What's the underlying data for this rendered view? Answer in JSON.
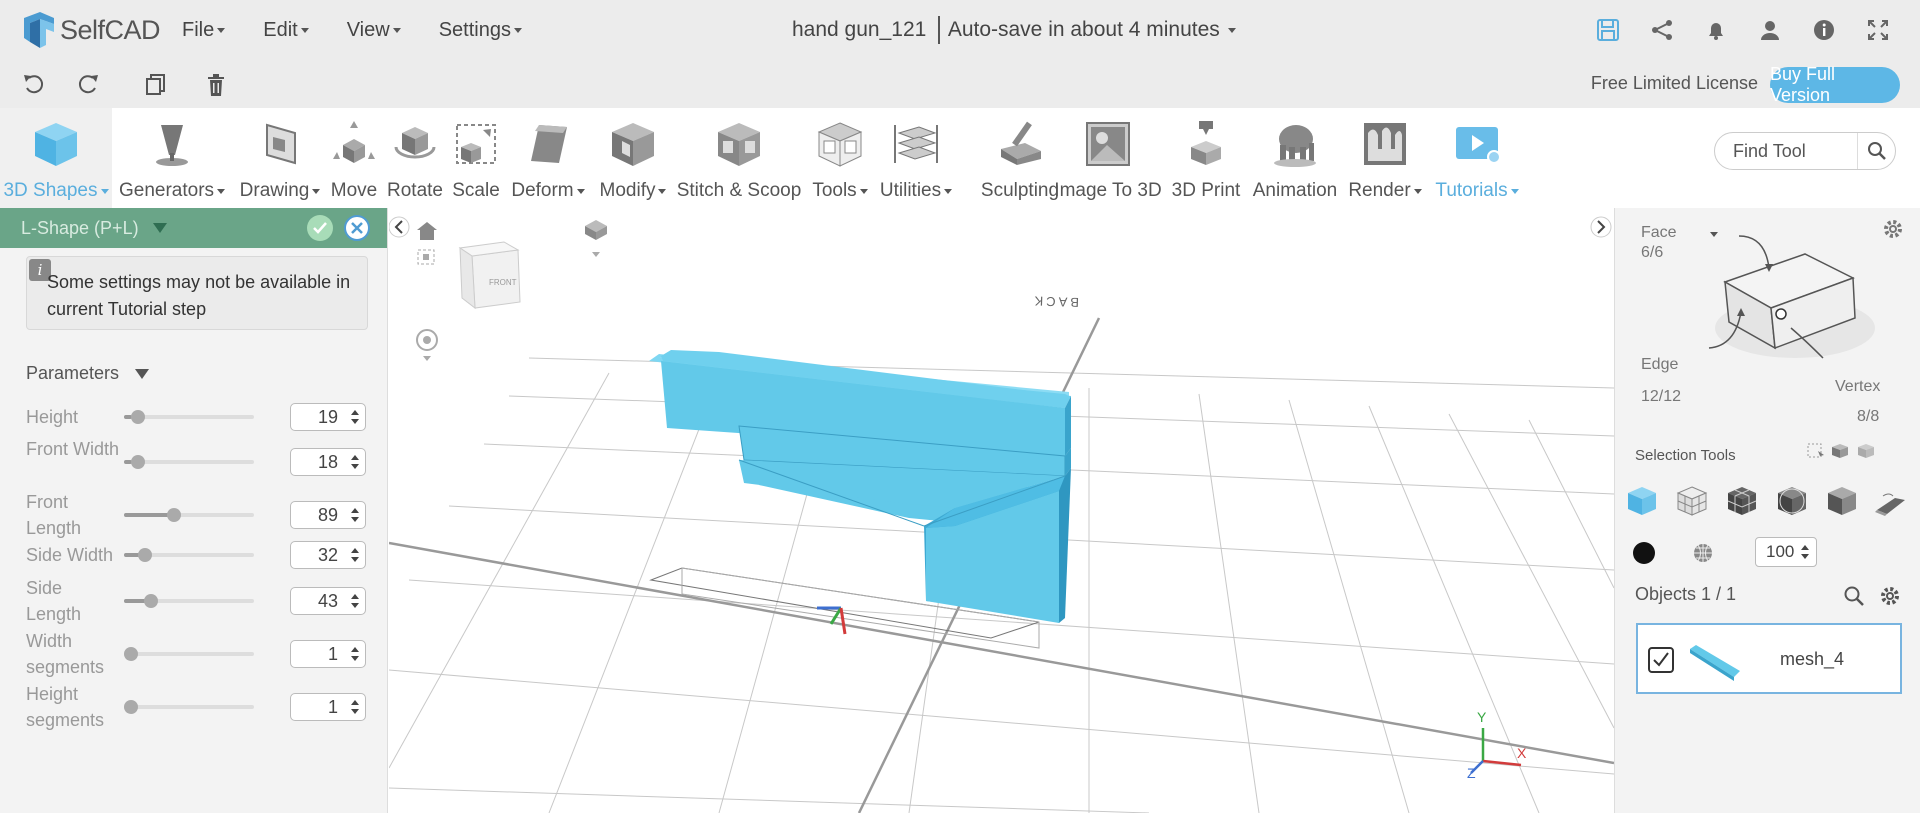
{
  "app": {
    "name": "SelfCAD"
  },
  "menu": [
    {
      "label": "File"
    },
    {
      "label": "Edit"
    },
    {
      "label": "View"
    },
    {
      "label": "Settings"
    }
  ],
  "document": {
    "title": "hand gun_121",
    "autosave": "Auto-save in about 4 minutes"
  },
  "top_icons": [
    "save-icon",
    "share-icon",
    "bell-icon",
    "user-icon",
    "info-icon",
    "fullscreen-icon"
  ],
  "license": {
    "text": "Free Limited License",
    "buy_label": "Buy Full Version"
  },
  "toolbar": {
    "items": [
      {
        "label": "3D Shapes",
        "caret": true,
        "active": true
      },
      {
        "label": "Generators",
        "caret": true
      },
      {
        "label": "Drawing",
        "caret": true
      },
      {
        "label": "Move"
      },
      {
        "label": "Rotate"
      },
      {
        "label": "Scale"
      },
      {
        "label": "Deform",
        "caret": true
      },
      {
        "label": "Modify",
        "caret": true
      },
      {
        "label": "Stitch & Scoop"
      },
      {
        "label": "Tools",
        "caret": true
      },
      {
        "label": "Utilities",
        "caret": true
      },
      {
        "label": "Sculpting"
      },
      {
        "label": "Image To 3D"
      },
      {
        "label": "3D Print"
      },
      {
        "label": "Animation"
      },
      {
        "label": "Render",
        "caret": true
      },
      {
        "label": "Tutorials",
        "caret": true,
        "active": true
      }
    ],
    "find_tool": "Find Tool"
  },
  "left_panel": {
    "title": "L-Shape (P+L)",
    "notice": "Some settings may not be available in current Tutorial step",
    "params_heading": "Parameters",
    "params": [
      {
        "label": "Height",
        "value": "19",
        "fraction": 0.06
      },
      {
        "label": "Front Width",
        "value": "18",
        "fraction": 0.06
      },
      {
        "label": "Front Length",
        "value": "89",
        "fraction": 0.37
      },
      {
        "label": "Side Width",
        "value": "32",
        "fraction": 0.12
      },
      {
        "label": "Side Length",
        "value": "43",
        "fraction": 0.17
      },
      {
        "label": "Width segments",
        "value": "1",
        "fraction": 0.0
      },
      {
        "label": "Height segments",
        "value": "1",
        "fraction": 0.0
      }
    ]
  },
  "viewport": {
    "view_cube_label": "FRONT",
    "back_label": "BACK",
    "axes": {
      "x": "X",
      "y": "Y",
      "z": "Z"
    },
    "model_color": "#62c9e9"
  },
  "right_panel": {
    "face_label": "Face",
    "face_count": "6/6",
    "edge_label": "Edge",
    "edge_count": "12/12",
    "vertex_label": "Vertex",
    "vertex_count": "8/8",
    "selection_tools_label": "Selection Tools",
    "opacity_value": "100",
    "objects_label": "Objects 1 / 1",
    "object_name": "mesh_4"
  },
  "colors": {
    "accent": "#5db7e6",
    "panel_header": "#6aa588"
  }
}
